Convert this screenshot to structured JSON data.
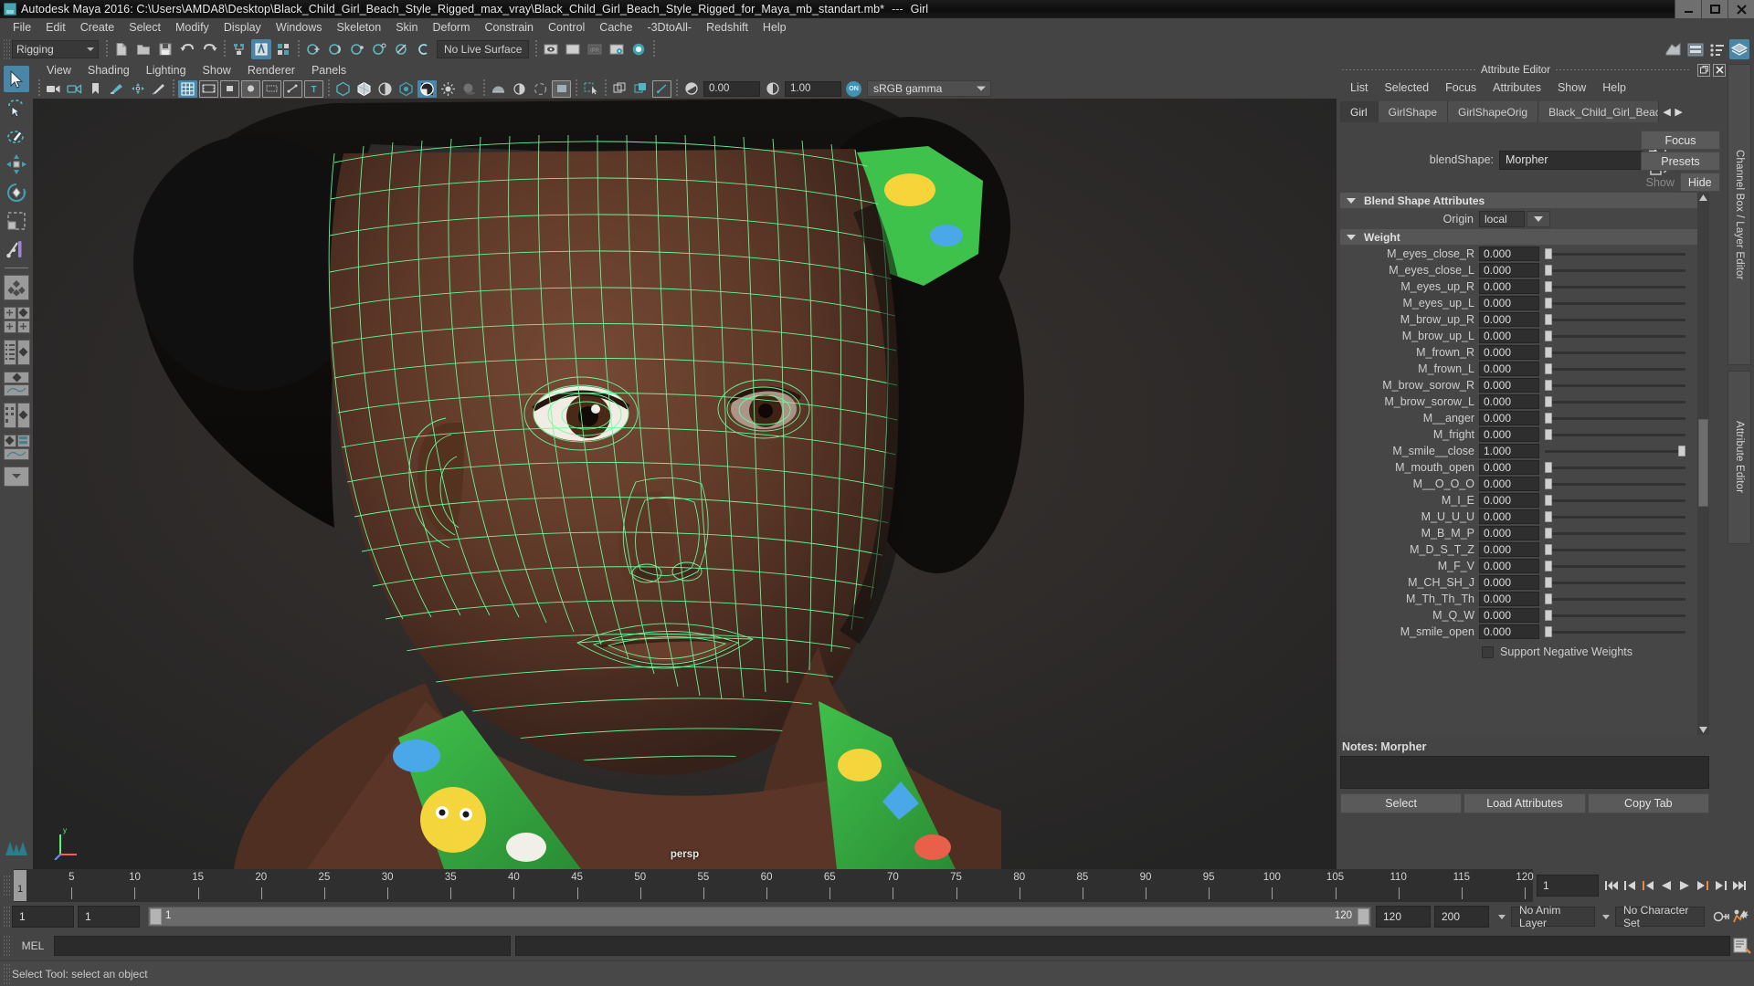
{
  "app": {
    "title": "Autodesk Maya 2016: C:\\Users\\AMDA8\\Desktop\\Black_Child_Girl_Beach_Style_Rigged_max_vray\\Black_Child_Girl_Beach_Style_Rigged_for_Maya_mb_standart.mb*",
    "title_separator": "---",
    "subtitle": "Girl",
    "window_buttons": {
      "minimize": "minimize-button",
      "maximize": "maximize-button",
      "close": "close-button"
    }
  },
  "menubar": {
    "items": [
      "File",
      "Edit",
      "Create",
      "Select",
      "Modify",
      "Display",
      "Windows",
      "Skeleton",
      "Skin",
      "Deform",
      "Constrain",
      "Control",
      "Cache",
      "-3DtoAll-",
      "Redshift",
      "Help"
    ]
  },
  "toolbar": {
    "mode": "Rigging",
    "live_surface": "No Live Surface"
  },
  "viewport": {
    "menu": [
      "View",
      "Shading",
      "Lighting",
      "Show",
      "Renderer",
      "Panels"
    ],
    "exposure": "0.00",
    "gamma_value": "1.00",
    "color_management": "sRGB gamma",
    "color_mgmt_toggle": "ON",
    "camera_label": "persp"
  },
  "attribute_editor": {
    "panel_title": "Attribute Editor",
    "menu": [
      "List",
      "Selected",
      "Focus",
      "Attributes",
      "Show",
      "Help"
    ],
    "tabs": [
      {
        "label": "Girl",
        "active": false
      },
      {
        "label": "GirlShape",
        "active": false
      },
      {
        "label": "GirlShapeOrig",
        "active": false
      },
      {
        "label": "Black_Child_Girl_Beach_Style_R",
        "active": true
      }
    ],
    "blendshape_label": "blendShape:",
    "blendshape_value": "Morpher",
    "focus_button": "Focus",
    "presets_button": "Presets",
    "show_button": "Show",
    "hide_button": "Hide",
    "section_blend_shape": "Blend Shape Attributes",
    "origin_label": "Origin",
    "origin_value": "local",
    "section_weight": "Weight",
    "weights": [
      {
        "name": "M_eyes_close_R",
        "value": "0.000",
        "pct": 0
      },
      {
        "name": "M_eyes_close_L",
        "value": "0.000",
        "pct": 0
      },
      {
        "name": "M_eyes_up_R",
        "value": "0.000",
        "pct": 0
      },
      {
        "name": "M_eyes_up_L",
        "value": "0.000",
        "pct": 0
      },
      {
        "name": "M_brow_up_R",
        "value": "0.000",
        "pct": 0
      },
      {
        "name": "M_brow_up_L",
        "value": "0.000",
        "pct": 0
      },
      {
        "name": "M_frown_R",
        "value": "0.000",
        "pct": 0
      },
      {
        "name": "M_frown_L",
        "value": "0.000",
        "pct": 0
      },
      {
        "name": "M_brow_sorow_R",
        "value": "0.000",
        "pct": 0
      },
      {
        "name": "M_brow_sorow_L",
        "value": "0.000",
        "pct": 0
      },
      {
        "name": "M__anger",
        "value": "0.000",
        "pct": 0
      },
      {
        "name": "M_fright",
        "value": "0.000",
        "pct": 0
      },
      {
        "name": "M_smile__close",
        "value": "1.000",
        "pct": 100
      },
      {
        "name": "M_mouth_open",
        "value": "0.000",
        "pct": 0
      },
      {
        "name": "M__O_O_O",
        "value": "0.000",
        "pct": 0
      },
      {
        "name": "M_I_E",
        "value": "0.000",
        "pct": 0
      },
      {
        "name": "M_U_U_U",
        "value": "0.000",
        "pct": 0
      },
      {
        "name": "M_B_M_P",
        "value": "0.000",
        "pct": 0
      },
      {
        "name": "M_D_S_T_Z",
        "value": "0.000",
        "pct": 0
      },
      {
        "name": "M_F_V",
        "value": "0.000",
        "pct": 0
      },
      {
        "name": "M_CH_SH_J",
        "value": "0.000",
        "pct": 0
      },
      {
        "name": "M_Th_Th_Th",
        "value": "0.000",
        "pct": 0
      },
      {
        "name": "M_Q_W",
        "value": "0.000",
        "pct": 0
      },
      {
        "name": "M_smile_open",
        "value": "0.000",
        "pct": 0
      }
    ],
    "support_negative_weights": "Support Negative Weights",
    "notes_label": "Notes:",
    "notes_value": "Morpher",
    "footer_buttons": [
      "Select",
      "Load Attributes",
      "Copy Tab"
    ]
  },
  "right_tabs": [
    "Channel Box / Layer Editor",
    "Attribute Editor"
  ],
  "timeline": {
    "current_frame": "1",
    "current_frame_field": "1",
    "ticks": [
      5,
      10,
      15,
      20,
      25,
      30,
      35,
      40,
      45,
      50,
      55,
      60,
      65,
      70,
      75,
      80,
      85,
      90,
      95,
      100,
      105,
      110,
      115,
      120
    ],
    "start": 1,
    "end": 120
  },
  "range_slider": {
    "anim_start": "1",
    "range_start": "1",
    "range_slider_left": "1",
    "range_slider_right": "120",
    "range_end": "120",
    "anim_end": "200",
    "anim_layer": "No Anim Layer",
    "character_set": "No Character Set"
  },
  "command_line": {
    "language": "MEL",
    "input_value": "",
    "output_value": ""
  },
  "status_bar": {
    "message": "Select Tool: select an object"
  },
  "colors": {
    "accent_blue": "#4a86a8",
    "panel_bg": "#444444",
    "field_bg": "#2e2e2e",
    "wireframe_green": "#6bff9e",
    "teal_icon": "#4aa3b0"
  }
}
